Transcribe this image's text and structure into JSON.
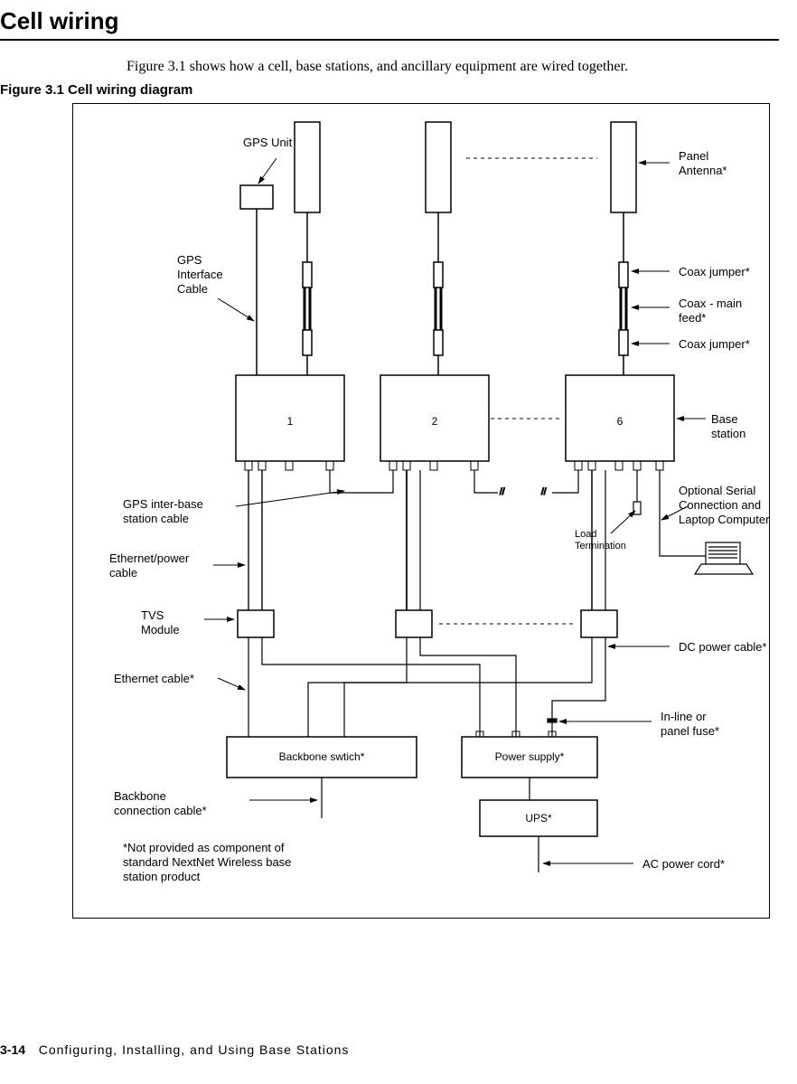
{
  "page": {
    "section_title": "Cell wiring",
    "intro": "Figure 3.1 shows how a cell, base stations, and ancillary equipment are wired together.",
    "figure_number": "Figure 3.1",
    "figure_title": "Cell wiring diagram",
    "footer_page": "3-14",
    "footer_title": "Configuring, Installing, and Using Base Stations"
  },
  "labels": {
    "gps_unit": "GPS Unit",
    "gps_interface_cable": "GPS\nInterface\nCable",
    "panel_antenna": "Panel\nAntenna*",
    "coax_jumper1": "Coax jumper*",
    "coax_main_feed": "Coax - main\nfeed*",
    "coax_jumper2": "Coax jumper*",
    "base_station": "Base station",
    "optional_serial": "Optional Serial\nConnection and\nLaptop Computer",
    "load_termination": "Load\nTermination",
    "gps_interbs_cable": "GPS inter-base\nstation cable",
    "ethernet_power_cable": "Ethernet/power\ncable",
    "tvs_module": "TVS\nModule",
    "ethernet_cable": "Ethernet cable*",
    "dc_power_cable": "DC power cable*",
    "inline_fuse": "In-line or\npanel fuse*",
    "backbone_switch": "Backbone swtich*",
    "power_supply": "Power supply*",
    "ups": "UPS*",
    "backbone_conn_cable": "Backbone\nconnection cable*",
    "ac_power_cord": "AC power cord*",
    "not_provided_note": "*Not provided as component of\nstandard NextNet Wireless base\nstation product"
  },
  "boxes": {
    "bs1": "1",
    "bs2": "2",
    "bs6": "6"
  }
}
